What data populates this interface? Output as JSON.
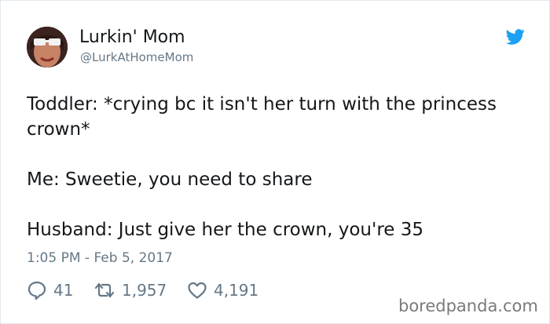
{
  "tweet": {
    "author_name": "Lurkin' Mom",
    "author_handle": "@LurkAtHomeMom",
    "lines": [
      "Toddler: *crying bc it isn't her turn with the princess crown*",
      "Me: Sweetie, you need to share",
      "Husband: Just give her the crown, you're 35"
    ],
    "timestamp": "1:05 PM - Feb 5, 2017",
    "replies": "41",
    "retweets": "1,957",
    "likes": "4,191"
  },
  "icons": {
    "brand": "twitter-bird-icon",
    "reply": "reply-icon",
    "retweet": "retweet-icon",
    "like": "heart-icon"
  },
  "colors": {
    "twitter_blue": "#1da1f2",
    "text": "#14171a",
    "secondary": "#657786",
    "watermark": "#7a7a7a"
  },
  "watermark": "boredpanda.com"
}
